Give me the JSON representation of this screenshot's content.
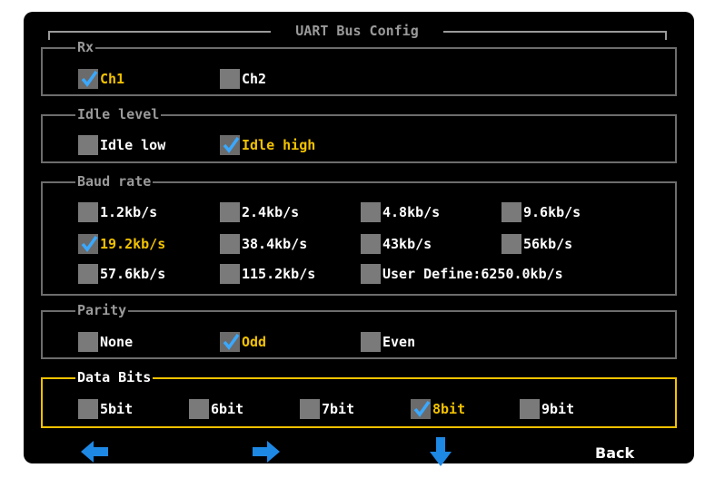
{
  "title": "UART Bus Config",
  "groups": {
    "rx": {
      "legend": "Rx",
      "options": [
        "Ch1",
        "Ch2"
      ],
      "selected": "Ch1"
    },
    "idle": {
      "legend": "Idle level",
      "options": [
        "Idle low",
        "Idle high"
      ],
      "selected": "Idle high"
    },
    "baud": {
      "legend": "Baud rate",
      "options": [
        "1.2kb/s",
        "2.4kb/s",
        "4.8kb/s",
        "9.6kb/s",
        "19.2kb/s",
        "38.4kb/s",
        "43kb/s",
        "56kb/s",
        "57.6kb/s",
        "115.2kb/s",
        "User Define:6250.0kb/s"
      ],
      "selected": "19.2kb/s"
    },
    "parity": {
      "legend": "Parity",
      "options": [
        "None",
        "Odd",
        "Even"
      ],
      "selected": "Odd"
    },
    "databits": {
      "legend": "Data Bits",
      "options": [
        "5bit",
        "6bit",
        "7bit",
        "8bit",
        "9bit"
      ],
      "selected": "8bit"
    }
  },
  "footer": {
    "left_icon": "arrow-left-icon",
    "right_icon": "arrow-right-icon",
    "down_icon": "arrow-down-icon",
    "back_label": "Back"
  },
  "colors": {
    "background": "#000000",
    "border": "#6d6d6d",
    "active_border": "#f2c200",
    "selected_text": "#f2c200",
    "checkmark": "#3aa8ff",
    "nav_arrow": "#1e88e5"
  }
}
